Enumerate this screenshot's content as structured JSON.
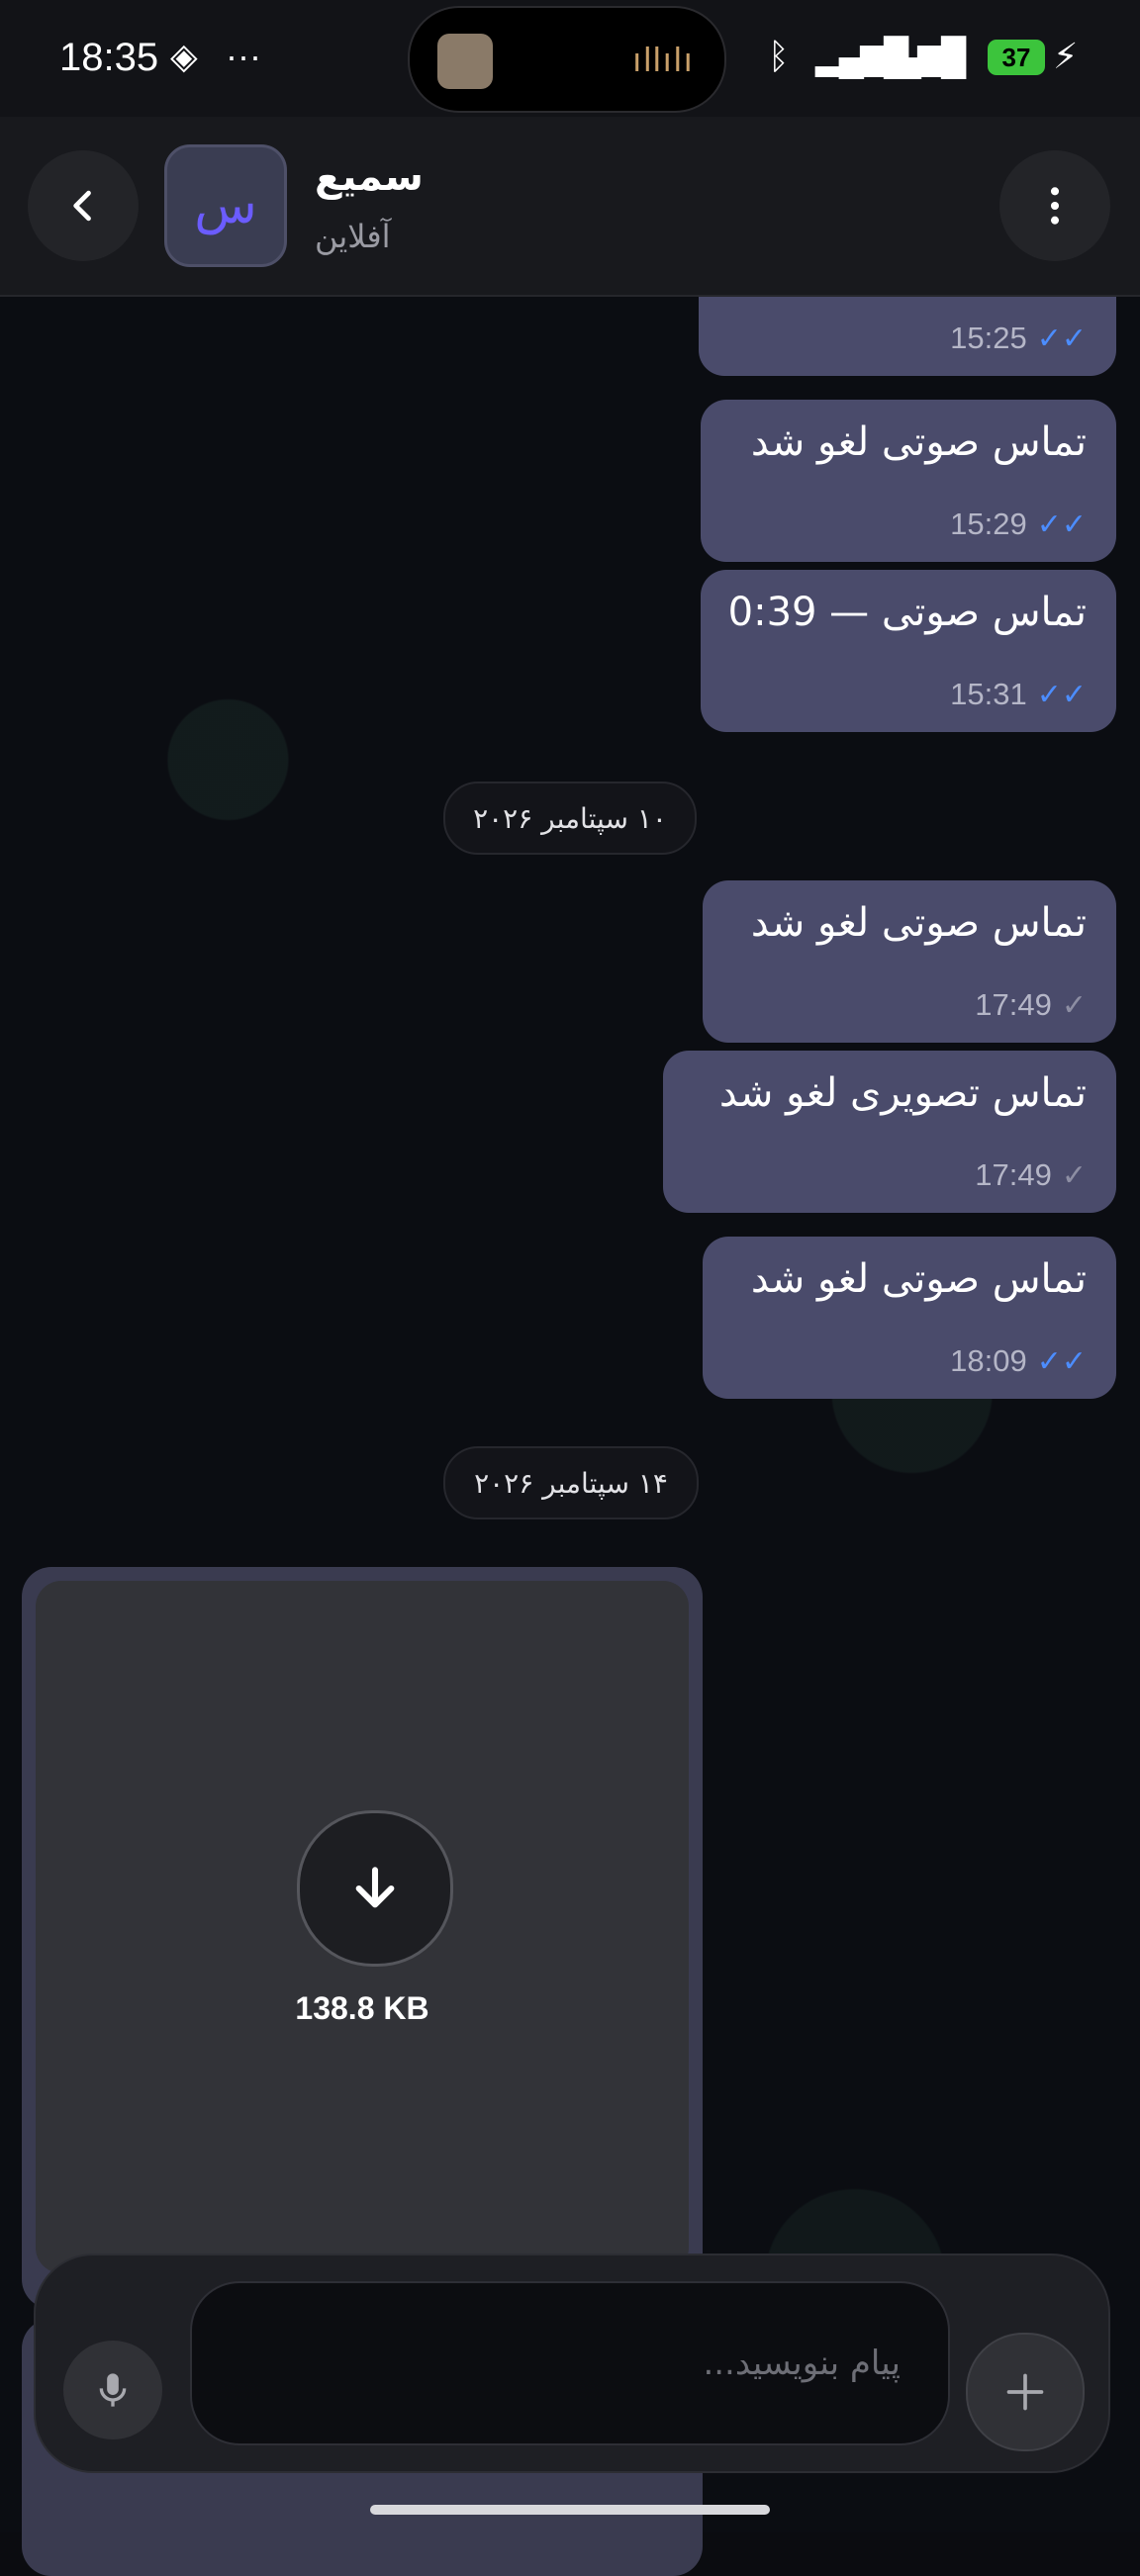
{
  "status_bar": {
    "time": "18:35",
    "extra_icons": [
      "nfc-icon",
      "more-dots-icon"
    ],
    "battery_level": "37",
    "icons": [
      "bluetooth-icon",
      "signal-icon",
      "signal-icon",
      "wifi-icon",
      "battery-icon",
      "charging-icon"
    ]
  },
  "header": {
    "contact_name": "سميع",
    "avatar_letter": "س",
    "status": "آفلاین"
  },
  "messages": [
    {
      "text": "",
      "time": "15:25",
      "status": "read"
    },
    {
      "text": "تماس صوتی لغو شد",
      "time": "15:29",
      "status": "read"
    },
    {
      "text": "تماس صوتی — 0:39",
      "time": "15:31",
      "status": "read"
    },
    {
      "text": "تماس صوتی لغو شد",
      "time": "17:49",
      "status": "sent"
    },
    {
      "text": "تماس تصویری لغو شد",
      "time": "17:49",
      "status": "sent"
    },
    {
      "text": "تماس صوتی لغو شد",
      "time": "18:09",
      "status": "read"
    }
  ],
  "date_separators": [
    "۱۰ سپتامبر ۲۰۲۶",
    "۱۴ سپتامبر ۲۰۲۶"
  ],
  "media": {
    "size": "138.8 KB"
  },
  "composer": {
    "placeholder": "پیام بنویسید..."
  },
  "colors": {
    "bubble_out": "#4a4b6b",
    "read_tick": "#4c8dff",
    "background": "#0b0d12"
  }
}
